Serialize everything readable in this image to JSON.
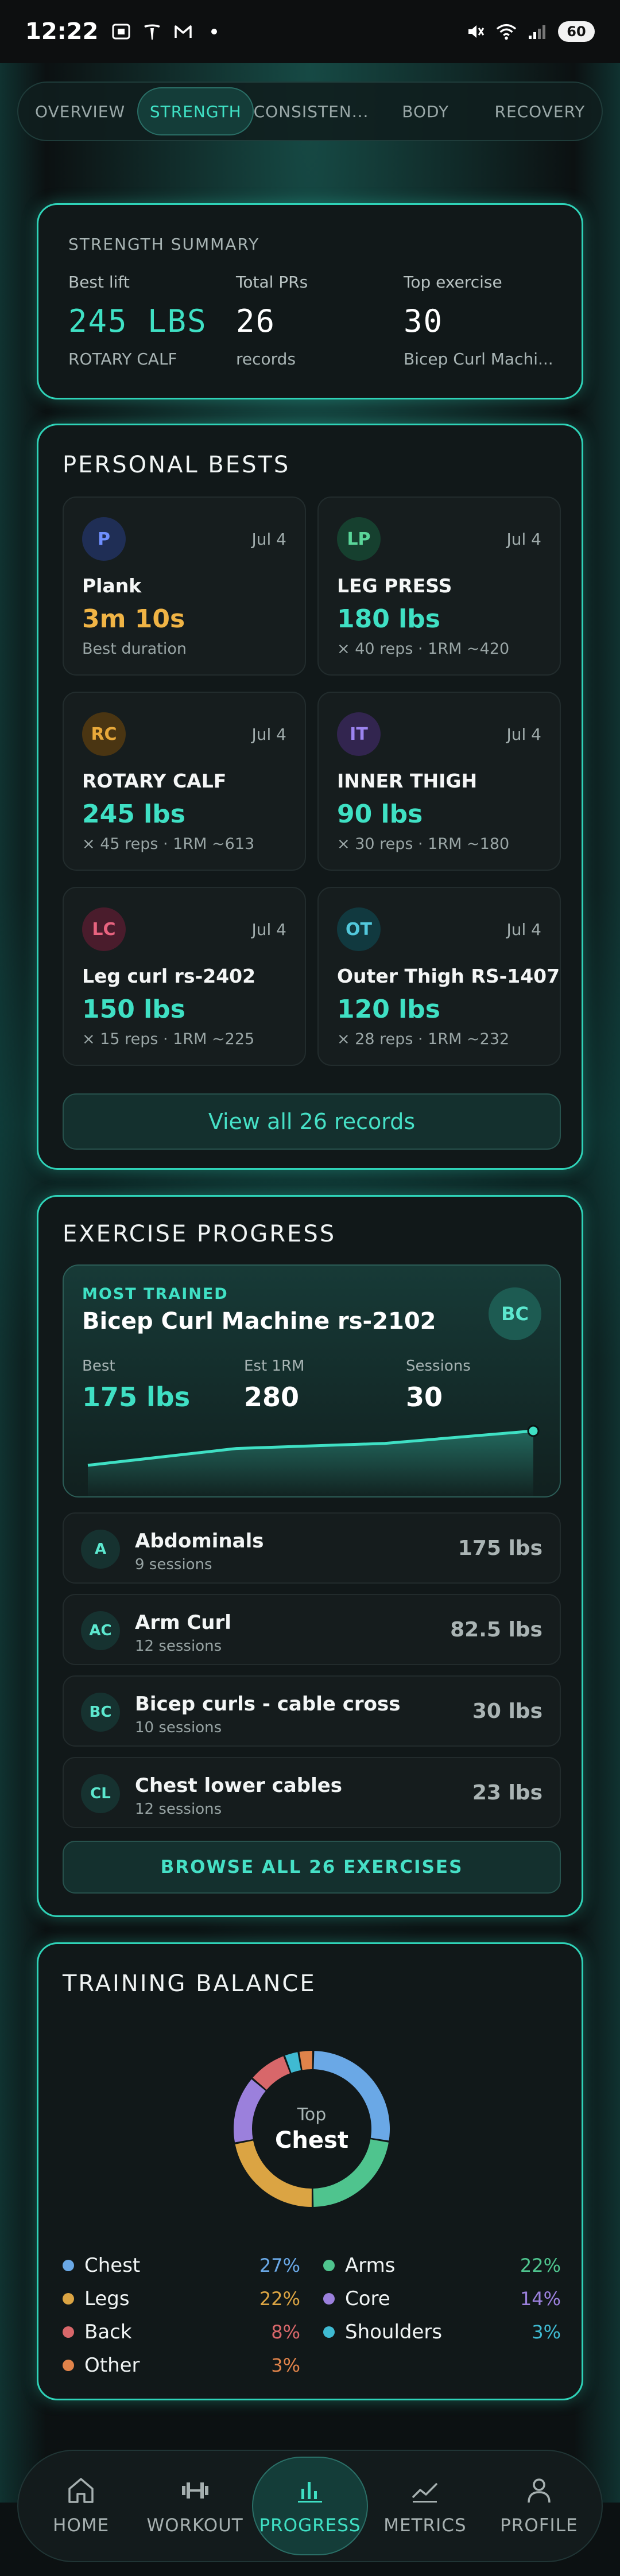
{
  "status_bar": {
    "time": "12:22",
    "battery": "60"
  },
  "tabs": [
    {
      "label": "OVERVIEW"
    },
    {
      "label": "STRENGTH"
    },
    {
      "label": "CONSISTEN..."
    },
    {
      "label": "BODY"
    },
    {
      "label": "RECOVERY"
    }
  ],
  "summary": {
    "title": "STRENGTH SUMMARY",
    "best_lift": {
      "label": "Best lift",
      "value": "245 LBS",
      "sub": "ROTARY CALF"
    },
    "total_prs": {
      "label": "Total PRs",
      "value": "26",
      "sub": "records"
    },
    "top_exercise": {
      "label": "Top exercise",
      "value": "30",
      "sub": "Bicep Curl Machi..."
    }
  },
  "personal_bests": {
    "title": "PERSONAL BESTS",
    "items": [
      {
        "badge": "P",
        "date": "Jul 4",
        "name": "Plank",
        "value": "3m 10s",
        "sub": "Best duration",
        "badge_bg": "#1f2e55",
        "badge_fg": "#6f8fff",
        "value_color": "#f0b445"
      },
      {
        "badge": "LP",
        "date": "Jul 4",
        "name": "LEG PRESS",
        "value": "180 lbs",
        "sub": "× 40 reps · 1RM ~420",
        "badge_bg": "#16402f",
        "badge_fg": "#5ad69a",
        "value_color": "#3fe0c4"
      },
      {
        "badge": "RC",
        "date": "Jul 4",
        "name": "ROTARY CALF",
        "value": "245 lbs",
        "sub": "× 45 reps · 1RM ~613",
        "badge_bg": "#4a3512",
        "badge_fg": "#e9a93a",
        "value_color": "#3fe0c4"
      },
      {
        "badge": "IT",
        "date": "Jul 4",
        "name": "INNER THIGH",
        "value": "90 lbs",
        "sub": "× 30 reps · 1RM ~180",
        "badge_bg": "#32254f",
        "badge_fg": "#9c84f0",
        "value_color": "#3fe0c4"
      },
      {
        "badge": "LC",
        "date": "Jul 4",
        "name": "Leg curl rs-2402",
        "value": "150 lbs",
        "sub": "× 15 reps · 1RM ~225",
        "badge_bg": "#4a1c2c",
        "badge_fg": "#e8637f",
        "value_color": "#3fe0c4"
      },
      {
        "badge": "OT",
        "date": "Jul 4",
        "name": "Outer Thigh RS-1407",
        "value": "120 lbs",
        "sub": "× 28 reps · 1RM ~232",
        "badge_bg": "#11393f",
        "badge_fg": "#52c8dc",
        "value_color": "#3fe0c4"
      }
    ],
    "view_all_label": "View all 26 records"
  },
  "exercise_progress": {
    "title": "EXERCISE PROGRESS",
    "most_trained": {
      "label": "MOST TRAINED",
      "name": "Bicep Curl Machine rs-2102",
      "badge": "BC",
      "best": {
        "label": "Best",
        "value": "175 lbs"
      },
      "est_1rm": {
        "label": "Est 1RM",
        "value": "280"
      },
      "sessions": {
        "label": "Sessions",
        "value": "30"
      },
      "trend": [
        0.12,
        0.55,
        0.68,
        1.0
      ]
    },
    "exercises": [
      {
        "badge": "A",
        "name": "Abdominals",
        "sub": "9 sessions",
        "value": "175 lbs"
      },
      {
        "badge": "AC",
        "name": "Arm Curl",
        "sub": "12 sessions",
        "value": "82.5 lbs"
      },
      {
        "badge": "BC",
        "name": "Bicep curls - cable cross",
        "sub": "10 sessions",
        "value": "30 lbs"
      },
      {
        "badge": "CL",
        "name": "Chest lower cables",
        "sub": "12 sessions",
        "value": "23 lbs"
      }
    ],
    "browse_label": "BROWSE ALL 26 EXERCISES"
  },
  "training_balance": {
    "title": "TRAINING BALANCE",
    "center_top": "Top",
    "center_value": "Chest",
    "segments": [
      {
        "name": "Chest",
        "pct": "27%",
        "value": 27,
        "color": "#6aa8e6"
      },
      {
        "name": "Arms",
        "pct": "22%",
        "value": 22,
        "color": "#4fc48e"
      },
      {
        "name": "Legs",
        "pct": "22%",
        "value": 22,
        "color": "#dba443"
      },
      {
        "name": "Core",
        "pct": "14%",
        "value": 14,
        "color": "#9b80dc"
      },
      {
        "name": "Back",
        "pct": "8%",
        "value": 8,
        "color": "#d8676a"
      },
      {
        "name": "Shoulders",
        "pct": "3%",
        "value": 3,
        "color": "#3fbad2"
      },
      {
        "name": "Other",
        "pct": "3%",
        "value": 3,
        "color": "#e0834a"
      }
    ]
  },
  "bottom_nav": [
    {
      "label": "HOME",
      "icon": "home-icon"
    },
    {
      "label": "WORKOUT",
      "icon": "dumbbell-icon"
    },
    {
      "label": "PROGRESS",
      "icon": "bar-chart-icon"
    },
    {
      "label": "METRICS",
      "icon": "line-chart-icon"
    },
    {
      "label": "PROFILE",
      "icon": "person-icon"
    }
  ],
  "colors": {
    "accent": "#3fe0c4",
    "card_border": "#2fd3b8",
    "background": "#0c1112"
  }
}
